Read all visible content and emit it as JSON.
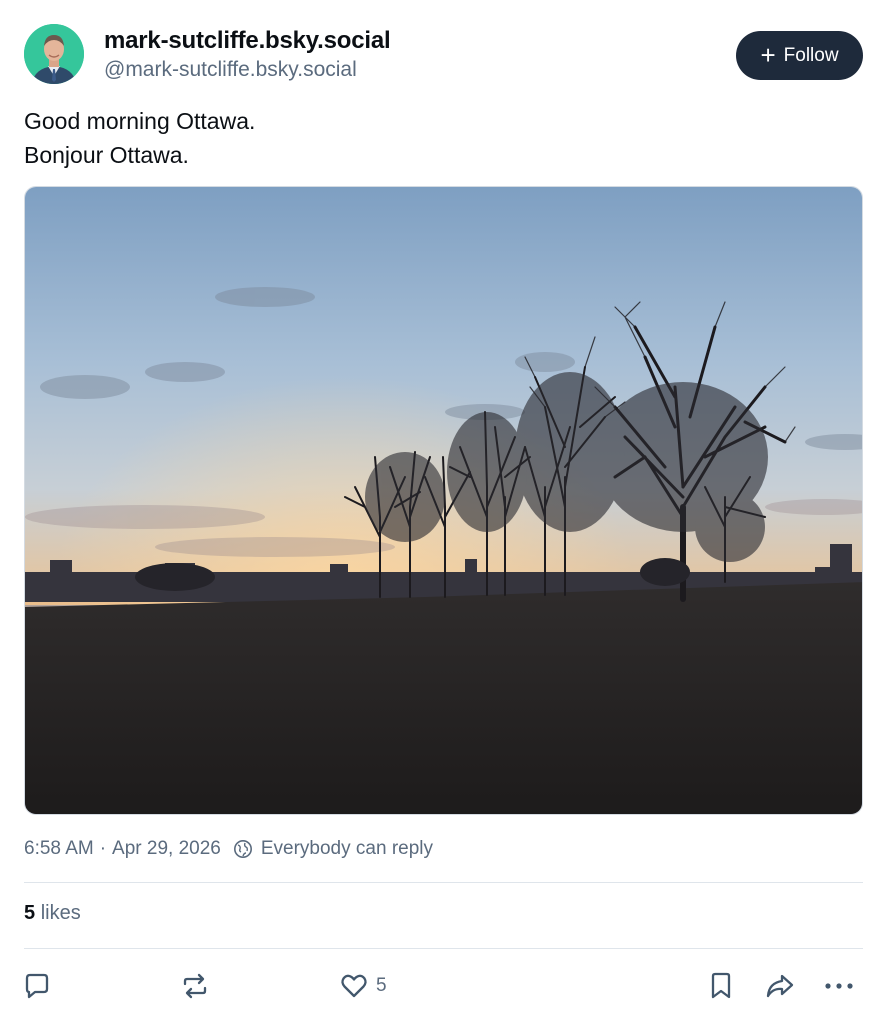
{
  "author": {
    "display_name": "mark-sutcliffe.bsky.social",
    "handle": "@mark-sutcliffe.bsky.social",
    "follow_label": "Follow"
  },
  "post": {
    "lines": [
      "Good morning Ottawa.",
      "Bonjour Ottawa."
    ],
    "timestamp": "6:58 AM",
    "separator": "·",
    "date": "Apr 29, 2026",
    "reply_setting": "Everybody can reply"
  },
  "engagement": {
    "likes_count": "5",
    "likes_label": "likes",
    "like_button_count": "5"
  },
  "icons": {
    "reply": "reply-icon",
    "repost": "repost-icon",
    "like": "heart-icon",
    "bookmark": "bookmark-icon",
    "share": "share-icon",
    "more": "more-icon",
    "globe": "globe-icon"
  },
  "colors": {
    "follow_bg": "#1e2a3b",
    "secondary_text": "#5b6b7e",
    "icon": "#42576c"
  }
}
